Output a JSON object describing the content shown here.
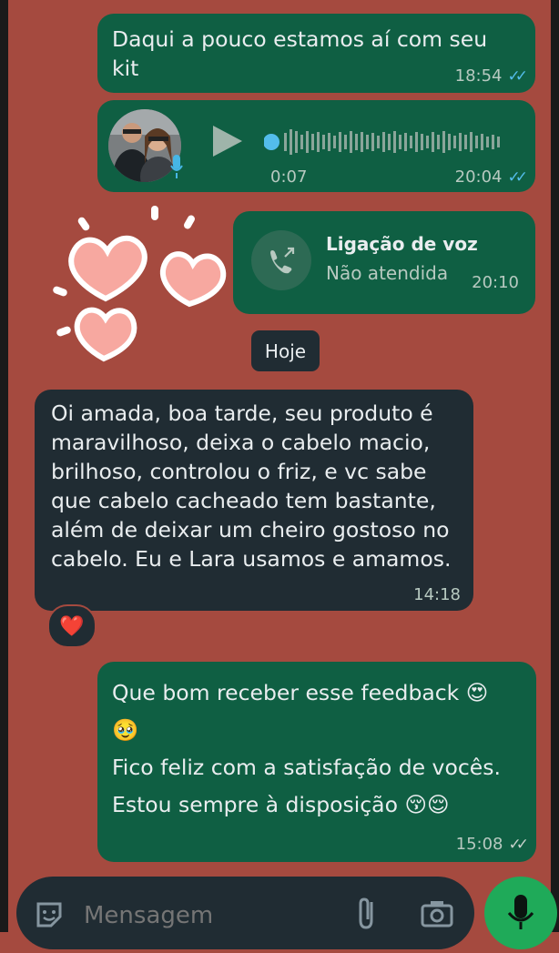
{
  "messages": {
    "m1": {
      "text": "Daqui a pouco estamos aí com seu kit",
      "time": "18:54"
    },
    "voice": {
      "duration": "0:07",
      "time": "20:04"
    },
    "call": {
      "title": "Ligação de voz",
      "status": "Não atendida",
      "time": "20:10"
    },
    "date_chip": "Hoje",
    "m2": {
      "text": "Oi amada, boa tarde, seu produto é maravilhoso, deixa o cabelo macio, brilhoso, controlou o friz, e vc sabe que cabelo cacheado tem bastante, além de deixar um cheiro gostoso no cabelo. Eu e Lara usamos e amamos.",
      "time": "14:18",
      "reaction": "❤️"
    },
    "m3": {
      "line1": "Que bom receber esse feedback",
      "emoji1": "😍",
      "emoji2": "🥹",
      "line2": "Fico feliz com a satisfação de vocês.",
      "line3": "Estou sempre à disposição",
      "emoji3": "😚😌",
      "time": "15:08"
    }
  },
  "composer": {
    "placeholder": "Mensagem"
  },
  "icons": {
    "read": "double-check-icon",
    "mic": "mic-icon",
    "attach": "paperclip-icon",
    "camera": "camera-icon",
    "sticker": "sticker-icon",
    "play": "play-icon",
    "call": "missed-call-icon"
  },
  "colors": {
    "wallpaper": "#a54a3f",
    "outgoing": "#0f5f43",
    "incoming": "#202c33",
    "read_ticks": "#53bdeb",
    "mic_button": "#1faa59"
  }
}
